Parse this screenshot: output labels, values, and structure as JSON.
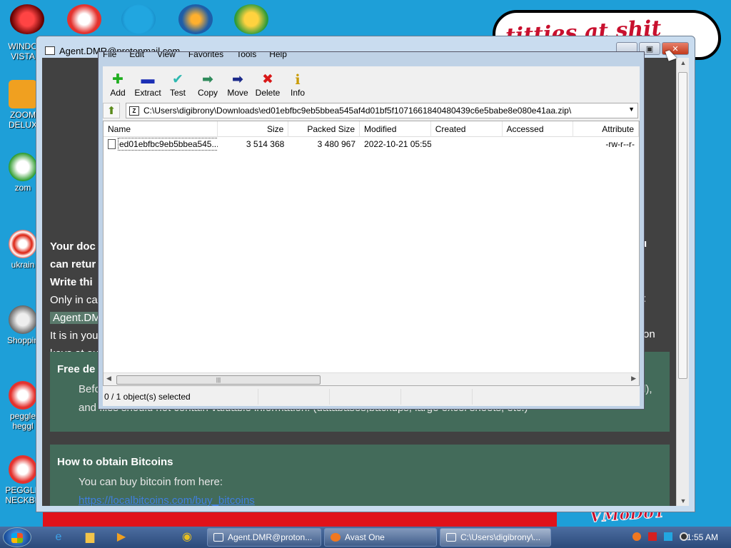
{
  "desktop": {
    "icons": [
      {
        "label": "WINDO\nVISTA"
      },
      {
        "label": "ZOOM\nDELUX"
      },
      {
        "label": "zom"
      },
      {
        "label": "ukrain"
      },
      {
        "label": "Shoppin"
      },
      {
        "label": "peggle\nheggl"
      },
      {
        "label": "PEGGLE\nNECKBE"
      }
    ],
    "cloud_text": "titties at shit",
    "vmobot_text": "VMoDoT"
  },
  "ransom_window": {
    "title": "Agent.DMR@protonmail.com",
    "lines": [
      "Your doc",
      "can retur",
      "Write thi",
      "Only in ca",
      "Agent.DM",
      "It is in you",
      "keys at ou"
    ],
    "right_fragments": [
      "u",
      "on"
    ],
    "right_colon": ":",
    "free_box": {
      "heading": "Free de",
      "line1": "Befo",
      "line1_end": "d),",
      "line2": "and files should not contain valuable information. (databases,backups, large excel sheets, etc.)"
    },
    "bitcoin_box": {
      "heading": "How to obtain Bitcoins",
      "line1": "You can buy bitcoin from here:",
      "link": "https://localbitcoins.com/buy_bitcoins"
    }
  },
  "zip": {
    "menu": [
      "File",
      "Edit",
      "View",
      "Favorites",
      "Tools",
      "Help"
    ],
    "toolbar": [
      {
        "label": "Add",
        "icon": "plus-icon",
        "glyph": "✚",
        "color": "#1fae1f"
      },
      {
        "label": "Extract",
        "icon": "minus-icon",
        "glyph": "▬",
        "color": "#1b2fb5"
      },
      {
        "label": "Test",
        "icon": "check-icon",
        "glyph": "✔",
        "color": "#2eb8b0"
      },
      {
        "label": "Copy",
        "icon": "copy-arrow-icon",
        "glyph": "➡",
        "color": "#2e8a5a"
      },
      {
        "label": "Move",
        "icon": "move-arrow-icon",
        "glyph": "➡",
        "color": "#1b2a8a"
      },
      {
        "label": "Delete",
        "icon": "delete-x-icon",
        "glyph": "✖",
        "color": "#d81818"
      },
      {
        "label": "Info",
        "icon": "info-icon",
        "glyph": "i",
        "color": "#c99a00"
      }
    ],
    "address": "C:\\Users\\digibrony\\Downloads\\ed01ebfbc9eb5bbea545af4d01bf5f1071661840480439c6e5babe8e080e41aa.zip\\",
    "columns": {
      "name": "Name",
      "size": "Size",
      "packed": "Packed Size",
      "modified": "Modified",
      "created": "Created",
      "accessed": "Accessed",
      "attributes": "Attribute"
    },
    "rows": [
      {
        "name": "ed01ebfbc9eb5bbea545...",
        "size": "3 514 368",
        "packed": "3 480 967",
        "modified": "2022-10-21 05:55",
        "created": "",
        "accessed": "",
        "attributes": "-rw-r--r-"
      }
    ],
    "status": "0 / 1 object(s) selected"
  },
  "taskbar": {
    "tasks": [
      {
        "label": "Agent.DMR@proton..."
      },
      {
        "label": "Avast One"
      },
      {
        "label": "C:\\Users\\digibrony\\..."
      }
    ],
    "clock": "1:55 AM"
  }
}
